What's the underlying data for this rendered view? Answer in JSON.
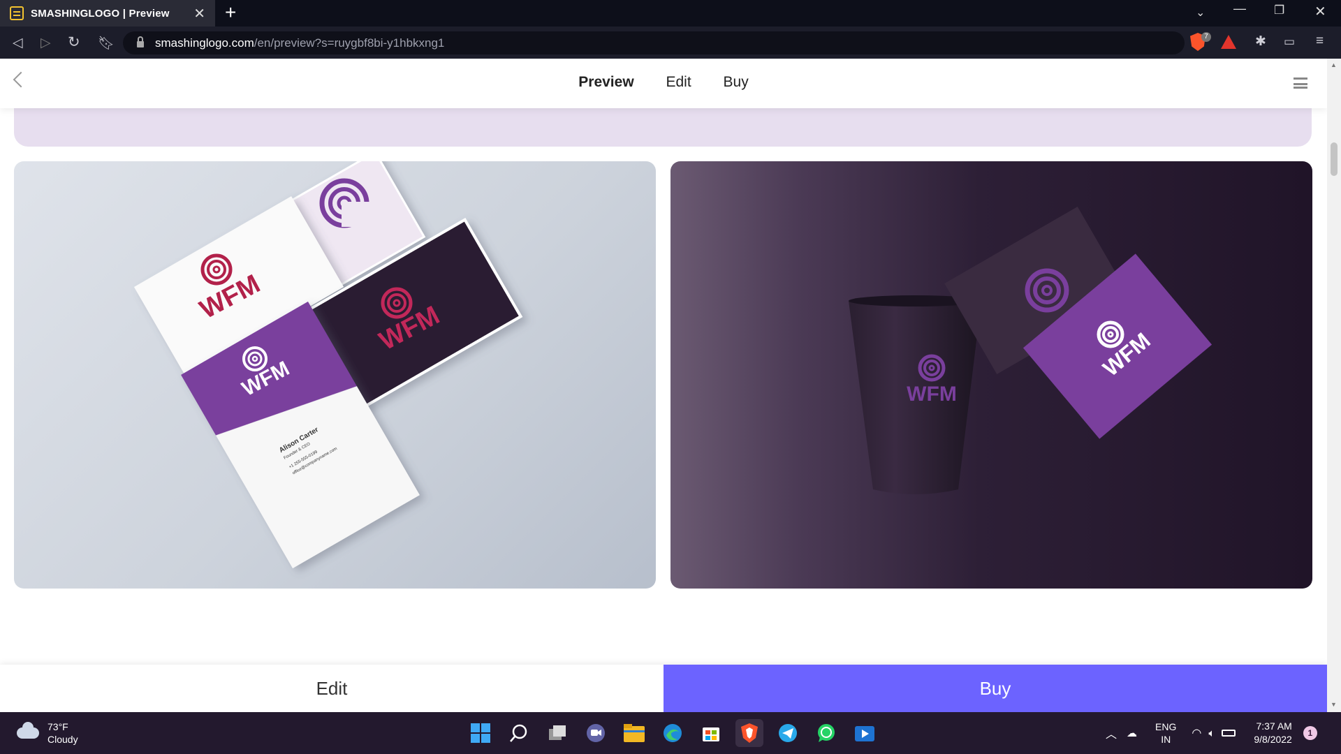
{
  "browser": {
    "tab_title": "SMASHINGLOGO | Preview",
    "tab_close": "✕",
    "new_tab": "+",
    "url_host": "smashinglogo.com",
    "url_path": "/en/preview?s=ruygbf8bi-y1hbkxng1",
    "brave_badge_count": "7"
  },
  "site_nav": {
    "links": [
      "Preview",
      "Edit",
      "Buy"
    ],
    "active": "Preview"
  },
  "mockups": {
    "brand": "WFM",
    "card_name": "Alison Carter",
    "card_title": "Founder & CEO",
    "card_phone": "+1 255-555-0199",
    "card_email": "office@companyname.com"
  },
  "colors": {
    "purple": "#7a3f9d",
    "crimson": "#b2214a",
    "dark_card": "#2a1a33",
    "buy_button": "#6c63ff"
  },
  "bottom_bar": {
    "edit_label": "Edit",
    "buy_label": "Buy"
  },
  "taskbar": {
    "temperature": "73°F",
    "condition": "Cloudy",
    "language": "ENG",
    "region": "IN",
    "time": "7:37 AM",
    "date": "9/8/2022",
    "notification_count": "1",
    "pinned_apps": [
      "start-icon",
      "search-icon",
      "task-view-icon",
      "chat-icon",
      "file-explorer-icon",
      "edge-icon",
      "store-icon",
      "brave-icon",
      "telegram-icon",
      "whatsapp-icon",
      "media-player-icon"
    ]
  }
}
